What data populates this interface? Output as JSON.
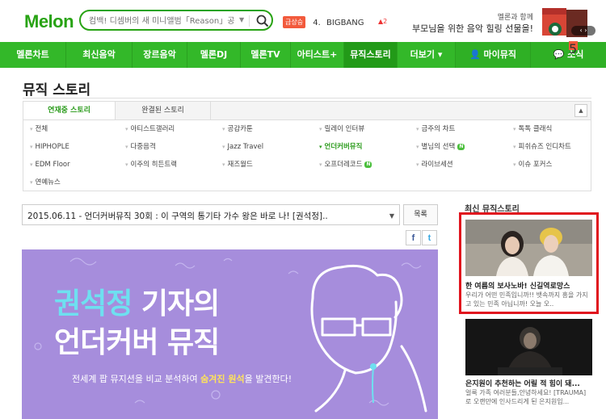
{
  "header": {
    "logo": "Melon",
    "search_placeholder": "컴백! 디셈버의 새 미니앨범「Reason」공개!",
    "trend_badge": "급상승",
    "trend_rank": "4.",
    "trend_text": "BIGBANG",
    "trend_change": "▲2",
    "promo_line1": "멜론과 함께",
    "promo_line2": "부모님을 위한 음악 힐링 선물을!"
  },
  "nav": {
    "items": [
      "멜론차트",
      "최신음악",
      "장르음악",
      "멜론DJ",
      "멜론TV",
      "아티스트+",
      "뮤직스토리",
      "더보기 ▾"
    ],
    "my_music": "마이뮤직",
    "news": "소식",
    "news_count": "5"
  },
  "page": {
    "title": "뮤직 스토리",
    "tab_active": "연재중 스토리",
    "tab_done": "완결된 스토리",
    "toggle": "▲"
  },
  "categories": [
    [
      "전체",
      "아티스트갤러리",
      "공감카툰",
      "릴레이 인터뷰",
      "금주의 차트",
      "톡톡 클래식"
    ],
    [
      "HIPHOPLE",
      "다중음격",
      "Jazz Travel",
      "언더커버뮤직",
      "별님의 선택",
      "피쉬슈즈 인디차트"
    ],
    [
      "EDM Floor",
      "이주의 히든트랙",
      "재즈월드",
      "오프더레코드",
      "라이브세션",
      "이슈 포커스"
    ],
    [
      "연예뉴스"
    ]
  ],
  "new_badge": "N",
  "article": {
    "selected": "2015.06.11 - 언더커버뮤직 30회 : 이 구역의 통기타 가수 왕은 바로 나! [권석정]..",
    "list_button": "목록",
    "share_fb": "f",
    "share_tw": "t"
  },
  "banner": {
    "line1_part1": "권석정",
    "line1_part2": "기자의",
    "line2": "언더커버 뮤직",
    "sub_pre": "전세계 팝 뮤지션을 비교 분석하여 ",
    "sub_hl": "숨겨진 원석",
    "sub_post": "을 발견한다!"
  },
  "sidebar": {
    "title": "최신 뮤직스토리",
    "card1_title": "한 여름의 보사노바! 신길역로망스",
    "card1_desc": "우리가 어떤 민족입니까!! 뱃속까지 흥을 가지고 있는 민족 아닙니까! 오늘 오..",
    "card2_title": "은지원이 추천하는 어릴 적 힘이 돼...",
    "card2_desc": "얼룩 가족 여러분들,안녕하세요! [TRAUMA] 로 오랜만에 인사드리게 된 은지원입..."
  },
  "colors": {
    "brand": "#33b829",
    "highlight": "#e0141e",
    "banner": "#a68ddc"
  }
}
